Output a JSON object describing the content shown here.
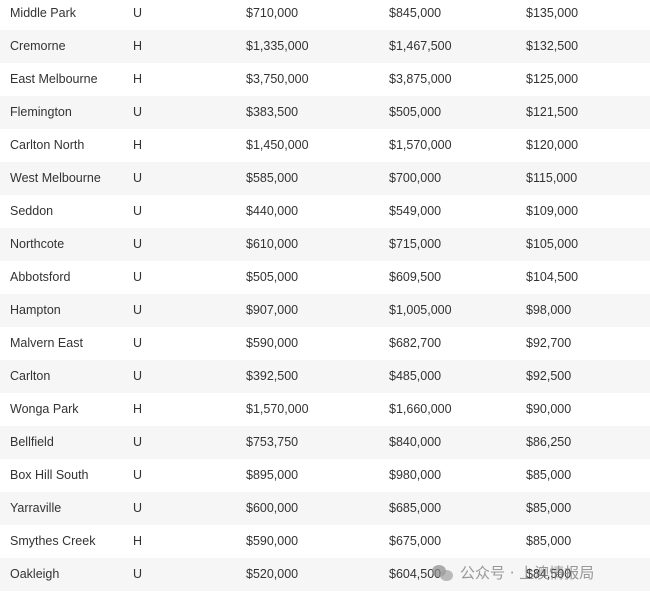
{
  "rows": [
    [
      "Middle Park",
      "U",
      "$710,000",
      "$845,000",
      "$135,000"
    ],
    [
      "Cremorne",
      "H",
      "$1,335,000",
      "$1,467,500",
      "$132,500"
    ],
    [
      "East Melbourne",
      "H",
      "$3,750,000",
      "$3,875,000",
      "$125,000"
    ],
    [
      "Flemington",
      "U",
      "$383,500",
      "$505,000",
      "$121,500"
    ],
    [
      "Carlton North",
      "H",
      "$1,450,000",
      "$1,570,000",
      "$120,000"
    ],
    [
      "West Melbourne",
      "U",
      "$585,000",
      "$700,000",
      "$115,000"
    ],
    [
      "Seddon",
      "U",
      "$440,000",
      "$549,000",
      "$109,000"
    ],
    [
      "Northcote",
      "U",
      "$610,000",
      "$715,000",
      "$105,000"
    ],
    [
      "Abbotsford",
      "U",
      "$505,000",
      "$609,500",
      "$104,500"
    ],
    [
      "Hampton",
      "U",
      "$907,000",
      "$1,005,000",
      "$98,000"
    ],
    [
      "Malvern East",
      "U",
      "$590,000",
      "$682,700",
      "$92,700"
    ],
    [
      "Carlton",
      "U",
      "$392,500",
      "$485,000",
      "$92,500"
    ],
    [
      "Wonga Park",
      "H",
      "$1,570,000",
      "$1,660,000",
      "$90,000"
    ],
    [
      "Bellfield",
      "U",
      "$753,750",
      "$840,000",
      "$86,250"
    ],
    [
      "Box Hill South",
      "U",
      "$895,000",
      "$980,000",
      "$85,000"
    ],
    [
      "Yarraville",
      "U",
      "$600,000",
      "$685,000",
      "$85,000"
    ],
    [
      "Smythes Creek",
      "H",
      "$590,000",
      "$675,000",
      "$85,000"
    ],
    [
      "Oakleigh",
      "U",
      "$520,000",
      "$604,500",
      "$84,500"
    ]
  ],
  "watermark": {
    "text": "公众号 · 上澳情报局",
    "icon": "wechat-icon"
  }
}
